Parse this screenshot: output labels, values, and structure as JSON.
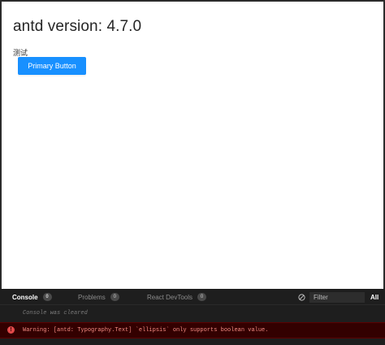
{
  "preview": {
    "heading": "antd version: 4.7.0",
    "text_label": "测试",
    "primary_button": "Primary Button"
  },
  "console": {
    "tabs": [
      {
        "label": "Console",
        "count": "0",
        "active": true
      },
      {
        "label": "Problems",
        "count": "0",
        "active": false
      },
      {
        "label": "React DevTools",
        "count": "0",
        "active": false
      }
    ],
    "filter_placeholder": "Filter",
    "level_toggle": "All",
    "cleared_message": "Console was cleared",
    "warning_message": "Warning: [antd: Typography.Text] `ellipsis` only supports boolean value.",
    "colors": {
      "primary": "#1890ff",
      "warning_bg": "#330000",
      "warning_text": "#f28b82",
      "error_icon": "#e24a4a"
    }
  }
}
